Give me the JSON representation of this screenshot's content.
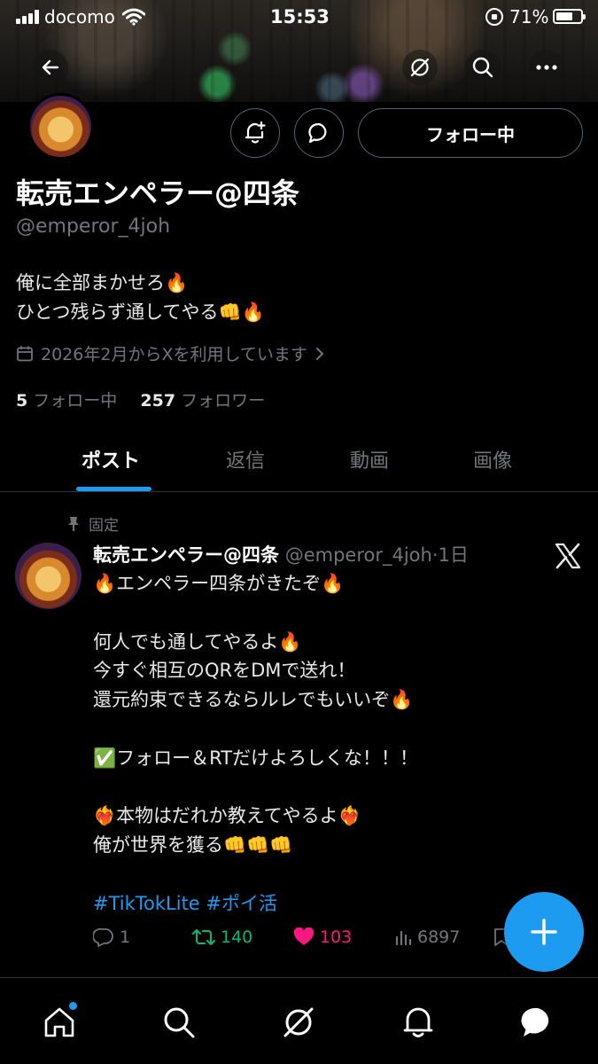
{
  "status_bar": {
    "carrier": "docomo",
    "time": "15:53",
    "battery": "71%",
    "battery_level": 0.71
  },
  "profile": {
    "display_name": "転売エンペラー@四条",
    "handle": "@emperor_4joh",
    "follow_button": "フォロー中",
    "bio_lines": [
      "俺に全部まかせろ🔥",
      "ひとつ残らず通してやる👊🔥"
    ],
    "joined": "2026年2月からXを利用しています",
    "following_count": "5",
    "following_label": "フォロー中",
    "followers_count": "257",
    "followers_label": "フォロワー"
  },
  "tabs": [
    "ポスト",
    "返信",
    "動画",
    "画像"
  ],
  "post": {
    "pinned_label": "固定",
    "author_name": "転売エンペラー@四条",
    "author_handle": "@emperor_4joh",
    "age": "1日",
    "lines": [
      "🔥エンペラー四条がきたぞ🔥",
      "",
      "何人でも通してやるよ🔥",
      "今すぐ相互のQRをDMで送れ！",
      "還元約束できるならルレでもいいぞ🔥",
      "",
      "✅フォロー＆RTだけよろしくな！！！",
      "",
      "❤️‍🔥本物はだれか教えてやるよ❤️‍🔥",
      "俺が世界を獲る👊👊👊",
      ""
    ],
    "hashtags": "#TikTokLite #ポイ活",
    "replies": "1",
    "reposts": "140",
    "likes": "103",
    "views": "6897"
  },
  "colors": {
    "accent": "#1d9bf0",
    "repost": "#00ba7c",
    "like": "#f91880",
    "muted": "#71767b"
  },
  "icons": {
    "back": "back-arrow-icon",
    "grok": "grok-icon",
    "search": "search-icon",
    "more": "more-icon",
    "notify": "notification-bell-icon",
    "message": "message-icon",
    "calendar": "calendar-icon",
    "pin": "pin-icon",
    "x_logo": "x-logo-icon",
    "compose": "plus-icon",
    "nav": [
      "home-icon",
      "search-icon",
      "grok-icon",
      "bell-icon",
      "messages-icon"
    ]
  }
}
